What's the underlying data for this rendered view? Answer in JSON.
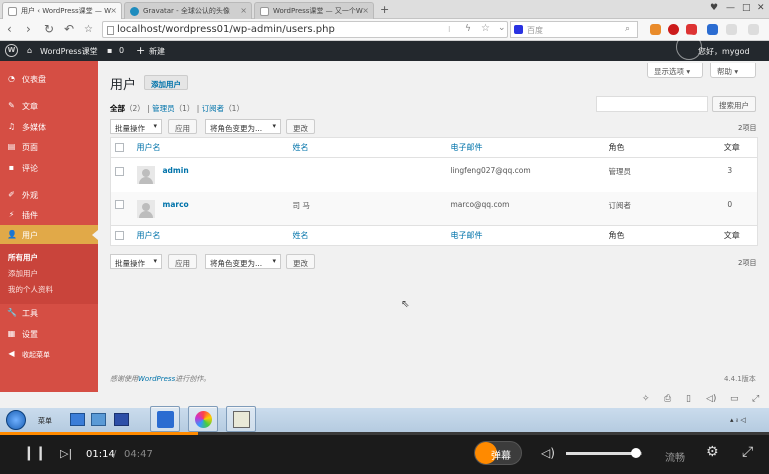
{
  "browser": {
    "tabs": [
      {
        "label": "用户 ‹ WordPress课堂 — W"
      },
      {
        "label": "Gravatar - 全球公认的头像"
      },
      {
        "label": "WordPress课堂 — 又一个W"
      }
    ],
    "url": "localhost/wordpress01/wp-admin/users.php",
    "search_placeholder": "百度"
  },
  "adminbar": {
    "site_name": "WordPress课堂",
    "comments_count": "0",
    "new_label": "新建",
    "greeting": "您好，mygod"
  },
  "sidebar": {
    "items": [
      {
        "label": "仪表盘",
        "icon": "dashboard-icon"
      },
      {
        "label": "文章",
        "icon": "pin-icon"
      },
      {
        "label": "多媒体",
        "icon": "media-icon"
      },
      {
        "label": "页面",
        "icon": "page-icon"
      },
      {
        "label": "评论",
        "icon": "comment-icon"
      },
      {
        "label": "外观",
        "icon": "brush-icon"
      },
      {
        "label": "插件",
        "icon": "plugin-icon"
      },
      {
        "label": "用户",
        "icon": "user-icon"
      },
      {
        "label": "工具",
        "icon": "wrench-icon"
      },
      {
        "label": "设置",
        "icon": "settings-icon"
      },
      {
        "label": "收起菜单",
        "icon": "collapse-icon"
      }
    ],
    "submenu": [
      "所有用户",
      "添加用户",
      "我的个人资料"
    ]
  },
  "main": {
    "screen_options": "显示选项",
    "help": "帮助",
    "title": "用户",
    "add_new": "添加用户",
    "filters": {
      "all": "全部",
      "all_count": "（2）",
      "admin": "管理员",
      "admin_count": "（1）",
      "subscriber": "订阅者",
      "subscriber_count": "（1）"
    },
    "search_button": "搜索用户",
    "bulk_action": "批量操作",
    "apply": "应用",
    "change_role": "将角色变更为...",
    "change": "更改",
    "item_count": "2项目",
    "columns": {
      "username": "用户名",
      "name": "姓名",
      "email": "电子邮件",
      "role": "角色",
      "posts": "文章"
    },
    "rows": [
      {
        "username": "admin",
        "name": "",
        "email": "lingfeng027@qq.com",
        "role": "管理员",
        "posts": "3"
      },
      {
        "username": "marco",
        "name": "司 马",
        "email": "marco@qq.com",
        "role": "订阅者",
        "posts": "0"
      }
    ],
    "footer_text": "感谢使用",
    "footer_link": "WordPress",
    "footer_suffix": "进行创作。",
    "version": "4.4.1版本"
  },
  "taskbar": {
    "start_label": "菜单"
  },
  "player": {
    "current_time": "01:14",
    "separator": " / ",
    "total_time": "04:47",
    "progress": 0.258,
    "danmu_label": "弹幕",
    "quality_label": "流畅",
    "volume": 0.92,
    "accent": "#ff8a00"
  }
}
